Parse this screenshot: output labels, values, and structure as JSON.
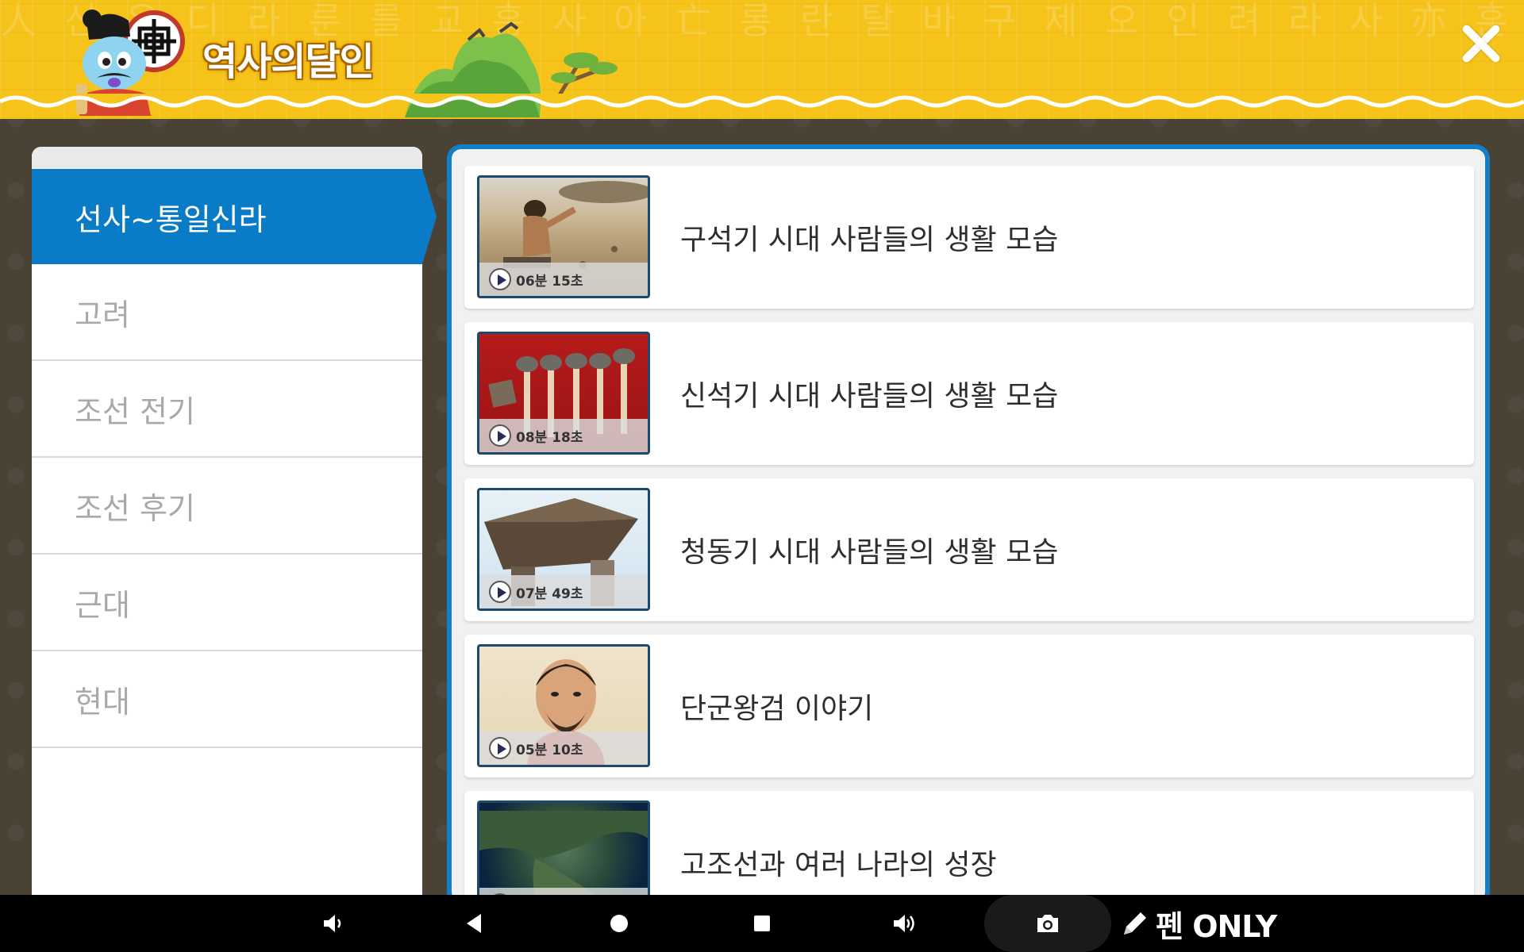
{
  "app": {
    "title": "역사의달인",
    "close_icon": "close-icon"
  },
  "header": {
    "background_glyphs": "人 신 은 디 라 룬 를 교 흥 사 아 亡 롱 란 탈 바 구 제 오 인 려 라 사 亦 훈 를 더 맵 마 마 가 로 학 난 잠 를 흥 오 야 노 성 사 스 하 인 신"
  },
  "sidebar": {
    "items": [
      {
        "label": "선사~통일신라",
        "active": true
      },
      {
        "label": "고려",
        "active": false
      },
      {
        "label": "조선 전기",
        "active": false
      },
      {
        "label": "조선 후기",
        "active": false
      },
      {
        "label": "근대",
        "active": false
      },
      {
        "label": "현대",
        "active": false
      }
    ]
  },
  "videos": [
    {
      "title": "구석기 시대 사람들의 생활 모습",
      "duration": "06분 15초"
    },
    {
      "title": "신석기 시대 사람들의 생활 모습",
      "duration": "08분 18초"
    },
    {
      "title": "청동기 시대 사람들의 생활 모습",
      "duration": "07분 49초"
    },
    {
      "title": "단군왕검 이야기",
      "duration": "05분 10초"
    },
    {
      "title": "고조선과 여러 나라의 성장",
      "duration": ""
    }
  ],
  "navbar": {
    "pen_label": "펜 ONLY",
    "icons": [
      "volume-down-icon",
      "back-icon",
      "home-icon",
      "recents-icon",
      "volume-up-icon",
      "camera-icon",
      "pen-icon"
    ]
  },
  "colors": {
    "header_yellow": "#f6c31a",
    "accent_blue": "#0a7cc7",
    "frame_blue": "#1180c8",
    "background_brown": "#4b4236"
  }
}
